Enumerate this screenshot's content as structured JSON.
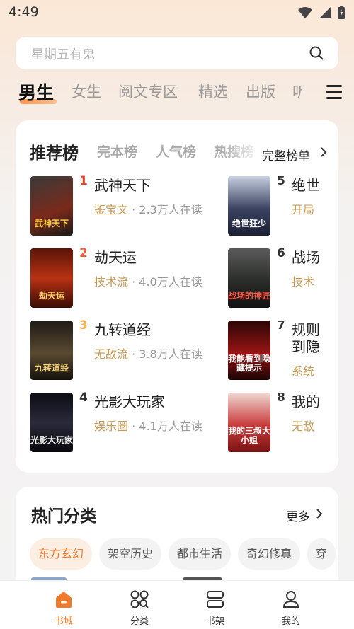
{
  "status_bar": {
    "time": "4:49"
  },
  "search": {
    "placeholder": "星期五有鬼"
  },
  "channel_tabs": [
    "男生",
    "女生",
    "阅文专区",
    "精选",
    "出版",
    "听"
  ],
  "ranking": {
    "tabs": [
      "推荐榜",
      "完本榜",
      "人气榜",
      "热搜榜"
    ],
    "full_list_label": "完整榜单",
    "books": [
      {
        "rank": "1",
        "title": "武神天下",
        "genre": "鉴宝文",
        "readers": " · 2.3万人在读",
        "cover_text": "武神天下"
      },
      {
        "rank": "2",
        "title": "劫天运",
        "genre": "技术流",
        "readers": " · 4.0万人在读",
        "cover_text": "劫天运"
      },
      {
        "rank": "3",
        "title": "九转道经",
        "genre": "无敌流",
        "readers": " · 3.8万人在读",
        "cover_text": "九转道经"
      },
      {
        "rank": "4",
        "title": "光影大玩家",
        "genre": "娱乐圈",
        "readers": " · 4.1万人在读",
        "cover_text": "光影大玩家"
      },
      {
        "rank": "5",
        "title": "绝世",
        "genre": "开局",
        "cover_text": "绝世狂少"
      },
      {
        "rank": "6",
        "title": "战场",
        "genre": "技术",
        "cover_text": "战场的神匠"
      },
      {
        "rank": "7",
        "title": "规则",
        "title_line2": "到隐",
        "genre": "系统",
        "cover_text": "我能看到隐藏提示"
      },
      {
        "rank": "8",
        "title": "我的",
        "genre": "无敌",
        "cover_text": "我的三叔大小姐"
      }
    ],
    "rank_colors": {
      "1": "#e8412c",
      "2": "#f05a3a",
      "3": "#f4b04a",
      "other": "#333333"
    }
  },
  "categories": {
    "title": "热门分类",
    "more_label": "更多",
    "chips": [
      "东方玄幻",
      "架空历史",
      "都市生活",
      "奇幻修真",
      "穿"
    ]
  },
  "bottom_nav": [
    {
      "label": "书城",
      "icon": "bookstore-icon",
      "active": true
    },
    {
      "label": "分类",
      "icon": "category-icon",
      "active": false
    },
    {
      "label": "书架",
      "icon": "bookshelf-icon",
      "active": false
    },
    {
      "label": "我的",
      "icon": "profile-icon",
      "active": false
    }
  ],
  "colors": {
    "accent": "#f07a2b",
    "genre": "#c69b55"
  }
}
